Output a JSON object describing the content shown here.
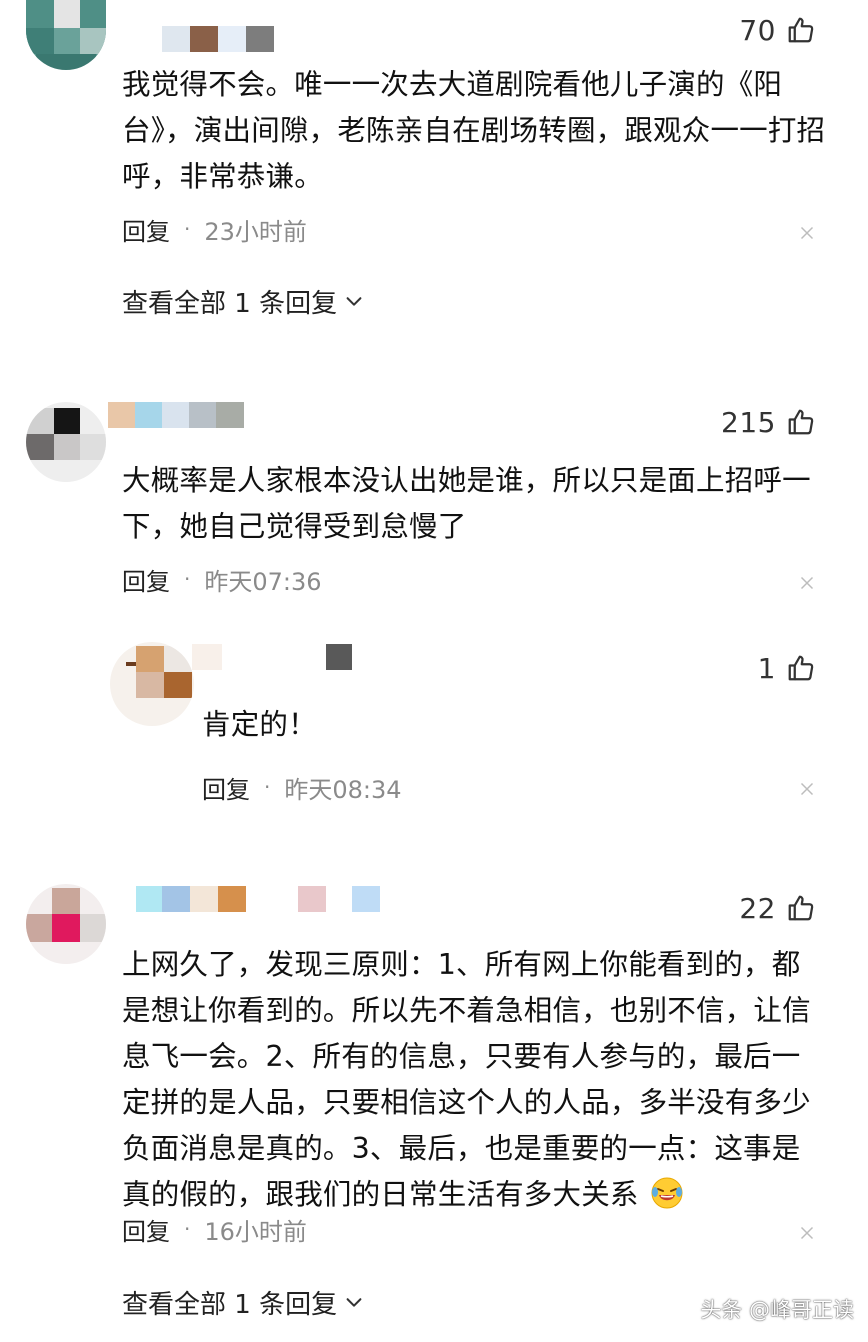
{
  "comments": [
    {
      "likes": "70",
      "text": "我觉得不会。唯一一次去大道剧院看他儿子演的《阳台》，演出间隙，老陈亲自在剧场转圈，跟观众一一打招呼，非常恭谦。",
      "reply_label": "回复",
      "dot": "·",
      "time": "23小时前",
      "view_all_label": "查看全部 1 条回复"
    },
    {
      "likes": "215",
      "text": "大概率是人家根本没认出她是谁，所以只是面上招呼一下，她自己觉得受到怠慢了",
      "reply_label": "回复",
      "dot": "·",
      "time": "昨天07:36",
      "sub_reply": {
        "likes": "1",
        "text": "肯定的！",
        "reply_label": "回复",
        "dot": "·",
        "time": "昨天08:34"
      }
    },
    {
      "likes": "22",
      "text": "上网久了，发现三原则：1、所有网上你能看到的，都是想让你看到的。所以先不着急相信，也别不信，让信息飞一会。2、所有的信息，只要有人参与的，最后一定拼的是人品，只要相信这个人的人品，多半没有多少负面消息是真的。3、最后，也是重要的一点：这事是真的假的，跟我们的日常生活有多大关系",
      "reply_label": "回复",
      "dot": "·",
      "time": "16小时前",
      "view_all_label": "查看全部 1 条回复"
    }
  ],
  "watermark": "头条 @峰哥正读",
  "icons": {
    "like": "thumbs-up-icon",
    "close": "close-icon",
    "expand": "chevron-down-icon",
    "emoji": "laughing-crying-emoji"
  },
  "colors": {
    "text": "#111111",
    "muted": "#8a8a8a",
    "icon": "#333333"
  }
}
